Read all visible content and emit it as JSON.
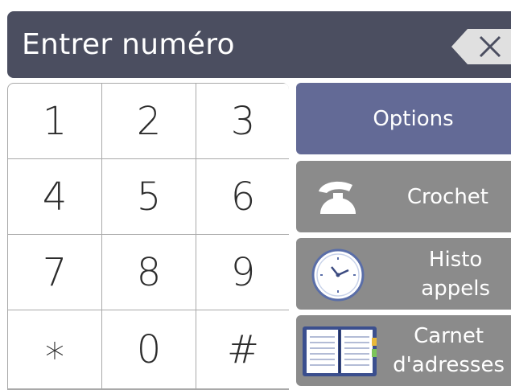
{
  "header": {
    "title": "Entrer numéro",
    "backspace_icon": "backspace-icon"
  },
  "keypad": {
    "keys": [
      "1",
      "2",
      "3",
      "4",
      "5",
      "6",
      "7",
      "8",
      "9",
      "∗",
      "0",
      "#"
    ]
  },
  "buttons": {
    "options": "Options",
    "crochet": "Crochet",
    "histo_line1": "Histo",
    "histo_line2": "appels",
    "carnet_line1": "Carnet",
    "carnet_line2": "d'adresses"
  },
  "icons": {
    "crochet": "phone-hook-icon",
    "histo": "clock-icon",
    "carnet": "address-book-icon"
  },
  "colors": {
    "header_bg": "#4b4e60",
    "options_bg": "#636a96",
    "side_btn_bg": "#8b8b8b",
    "key_bg": "#ffffff",
    "grid_lines": "#a9a9a9"
  }
}
